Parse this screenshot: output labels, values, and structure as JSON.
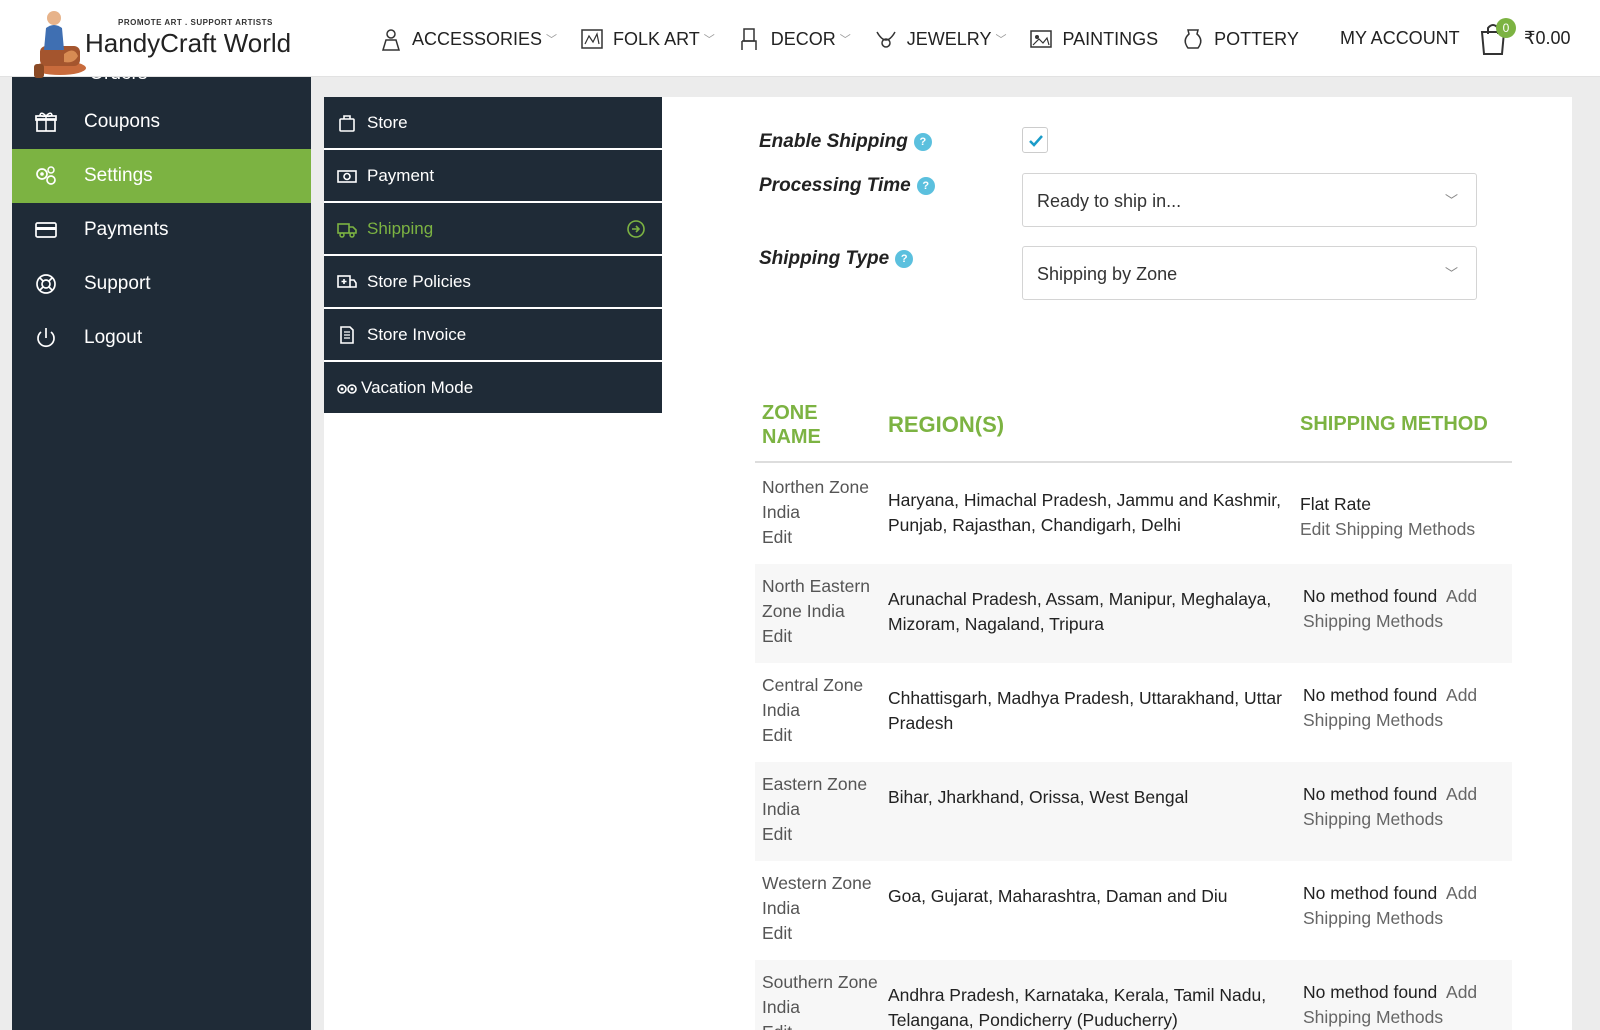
{
  "brand": {
    "name": "HandyCraft World",
    "tagline": "PROMOTE ART . SUPPORT ARTISTS"
  },
  "nav": {
    "items": [
      {
        "label": "ACCESSORIES",
        "icon": "accessories-icon",
        "dropdown": true
      },
      {
        "label": "FOLK ART",
        "icon": "folk-art-icon",
        "dropdown": true
      },
      {
        "label": "DECOR",
        "icon": "decor-icon",
        "dropdown": true
      },
      {
        "label": "JEWELRY",
        "icon": "jewelry-icon",
        "dropdown": true
      },
      {
        "label": "PAINTINGS",
        "icon": "paintings-icon",
        "dropdown": false
      },
      {
        "label": "POTTERY",
        "icon": "pottery-icon",
        "dropdown": false
      }
    ],
    "account": "MY ACCOUNT",
    "cart_count": "0",
    "cart_total": "₹0.00"
  },
  "sidebar": {
    "cut_label": "Orders",
    "items": [
      {
        "label": "Coupons",
        "icon": "gift-icon",
        "active": false
      },
      {
        "label": "Settings",
        "icon": "gears-icon",
        "active": true
      },
      {
        "label": "Payments",
        "icon": "credit-card-icon",
        "active": false
      },
      {
        "label": "Support",
        "icon": "lifebuoy-icon",
        "active": false
      },
      {
        "label": "Logout",
        "icon": "power-icon",
        "active": false
      }
    ]
  },
  "tabs": [
    {
      "label": "Store",
      "icon": "bag-icon",
      "active": false
    },
    {
      "label": "Payment",
      "icon": "money-icon",
      "active": false
    },
    {
      "label": "Shipping",
      "icon": "truck-icon",
      "active": true
    },
    {
      "label": "Store Policies",
      "icon": "ambulance-icon",
      "active": false
    },
    {
      "label": "Store Invoice",
      "icon": "document-icon",
      "active": false
    },
    {
      "label": "Vacation Mode",
      "icon": "binoculars-icon",
      "active": false
    }
  ],
  "form": {
    "enable_shipping_label": "Enable Shipping",
    "enable_shipping_checked": true,
    "processing_time_label": "Processing Time",
    "processing_time_value": "Ready to ship in...",
    "shipping_type_label": "Shipping Type",
    "shipping_type_value": "Shipping by Zone",
    "help_glyph": "?"
  },
  "table": {
    "headers": {
      "zone": "ZONE NAME",
      "regions": "REGION(S)",
      "method": "SHIPPING METHOD"
    },
    "rows": [
      {
        "zone": "Northen Zone India",
        "edit": "Edit",
        "regions": "Haryana, Himachal Pradesh, Jammu and Kashmir, Punjab, Rajasthan, Chandigarh, Delhi",
        "method": "Flat Rate",
        "method_link": "Edit Shipping Methods"
      },
      {
        "zone": "North Eastern Zone India",
        "edit": "Edit",
        "regions": "Arunachal Pradesh, Assam, Manipur, Meghalaya, Mizoram, Nagaland, Tripura",
        "method": "No method found",
        "method_link": "Add Shipping Methods"
      },
      {
        "zone": "Central Zone India",
        "edit": "Edit",
        "regions": "Chhattisgarh, Madhya Pradesh, Uttarakhand, Uttar Pradesh",
        "method": "No method found",
        "method_link": "Add Shipping Methods"
      },
      {
        "zone": "Eastern Zone India",
        "edit": "Edit",
        "regions": "Bihar, Jharkhand, Orissa, West Bengal",
        "method": "No method found",
        "method_link": "Add Shipping Methods"
      },
      {
        "zone": "Western Zone India",
        "edit": "Edit",
        "regions": "Goa, Gujarat, Maharashtra, Daman and Diu",
        "method": "No method found",
        "method_link": "Add Shipping Methods"
      },
      {
        "zone": "Southern Zone India",
        "edit": "Edit",
        "regions": "Andhra Pradesh, Karnataka, Kerala, Tamil Nadu, Telangana, Pondicherry (Puducherry)",
        "method": "No method found",
        "method_link": "Add Shipping Methods"
      }
    ]
  },
  "colors": {
    "accent": "#7cb342",
    "sidebar": "#1f2b37",
    "help": "#5bc0de",
    "check": "#1a9cc9"
  }
}
